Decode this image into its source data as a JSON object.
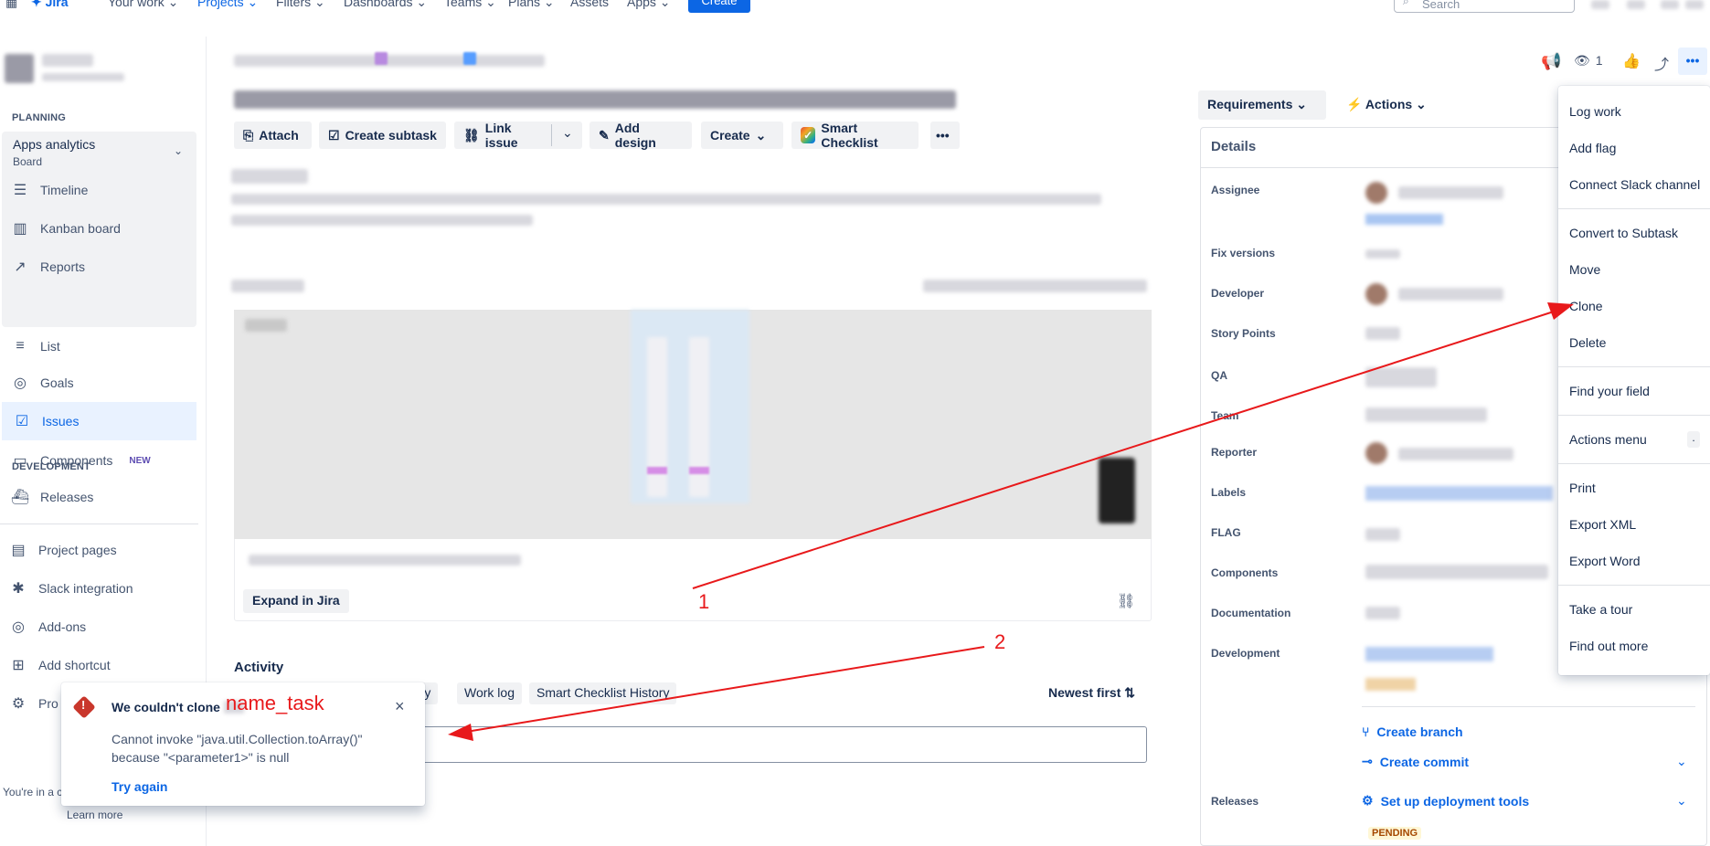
{
  "topnav": {
    "product": "Jira",
    "items": [
      "Your work ⌄",
      "Projects ⌄",
      "Filters ⌄",
      "Dashboards ⌄",
      "Teams ⌄",
      "Plans ⌄",
      "Assets",
      "Apps ⌄"
    ],
    "create": "Create",
    "search_placeholder": "Search"
  },
  "sidebar": {
    "planning_label": "PLANNING",
    "board_name": "Apps analytics",
    "board_sub": "Board",
    "items": [
      "Timeline",
      "Kanban board",
      "Reports",
      "List",
      "Goals",
      "Issues",
      "Components"
    ],
    "new_badge": "NEW",
    "development_label": "DEVELOPMENT",
    "dev_items": [
      "Releases"
    ],
    "bottom_items": [
      "Project pages",
      "Slack integration",
      "Add-ons",
      "Add shortcut",
      "Pro"
    ],
    "footer_text": "You're in a c",
    "learn_more": "Learn more"
  },
  "toolbar": {
    "attach": "Attach",
    "create_subtask": "Create subtask",
    "link_issue": "Link issue",
    "add_design": "Add design",
    "create": "Create",
    "smart_checklist": "Smart Checklist",
    "more": "•••"
  },
  "media": {
    "expand": "Expand in Jira"
  },
  "activity": {
    "title": "Activity",
    "tabs": [
      "tory",
      "Work log",
      "Smart Checklist History"
    ],
    "sort": "Newest first",
    "hint_fragment": "t"
  },
  "right": {
    "requirements": "Requirements",
    "actions": "Actions",
    "details": "Details",
    "fields": [
      "Assignee",
      "Fix versions",
      "Developer",
      "Story Points",
      "QA",
      "Team",
      "Reporter",
      "Labels",
      "FLAG",
      "Components",
      "Documentation",
      "Development"
    ],
    "create_branch": "Create branch",
    "create_commit": "Create commit",
    "releases_label": "Releases",
    "setup_tools": "Set up deployment tools",
    "pending": "PENDING",
    "watch_count": "1"
  },
  "menu": {
    "items_group1": [
      "Log work",
      "Add flag",
      "Connect Slack channel"
    ],
    "items_group2": [
      "Convert to Subtask",
      "Move",
      "Clone",
      "Delete"
    ],
    "items_group3": [
      "Find your field"
    ],
    "items_group4": [
      "Actions menu"
    ],
    "actions_shortcut": ".",
    "items_group5": [
      "Print",
      "Export XML",
      "Export Word"
    ],
    "items_group6": [
      "Take a tour",
      "Find out more"
    ]
  },
  "flag": {
    "title": "We couldn't clone",
    "task_name": "name_task",
    "body": "Cannot invoke \"java.util.Collection.toArray()\" because \"<parameter1>\" is null",
    "try_again": "Try again"
  },
  "annotations": {
    "label1": "1",
    "label2": "2",
    "color": "#e8191b"
  }
}
